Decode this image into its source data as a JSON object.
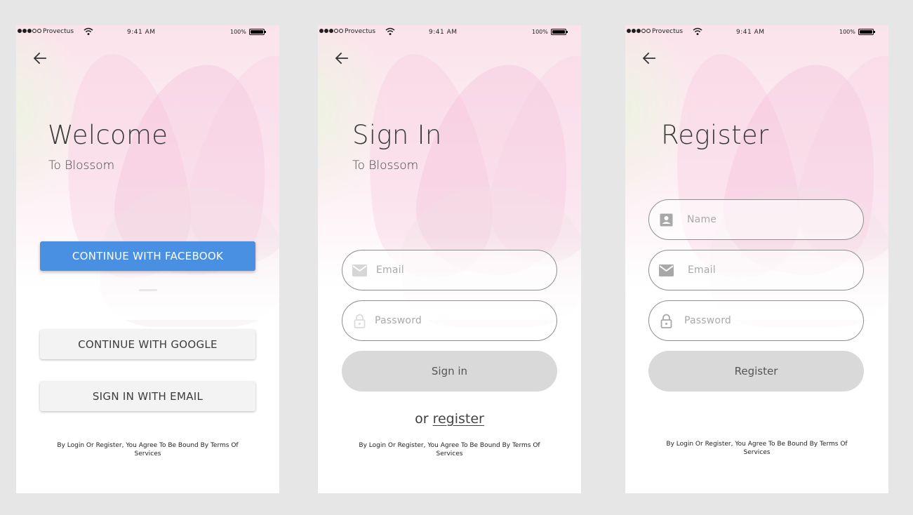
{
  "status_bar": {
    "carrier": "Provectus",
    "signal_bars_filled": 3,
    "signal_bars_total": 5,
    "time": "9:41 AM",
    "battery": "100%"
  },
  "colors": {
    "facebook_blue": "#4a90e2",
    "light_button": "#f3f3f3",
    "pill_button": "#d9d9d9",
    "canvas": "#e6e6e6"
  },
  "welcome": {
    "back_icon": "arrow-left-icon",
    "title": "Welcome",
    "subtitle": "To Blossom",
    "facebook_button": "CONTINUE WITH FACEBOOK",
    "google_button": "CONTINUE WITH GOOGLE",
    "email_button": "SIGN IN WITH EMAIL",
    "terms": "By Login Or Register, You Agree To Be Bound By Terms Of Services"
  },
  "signin": {
    "back_icon": "arrow-left-icon",
    "title": "Sign In",
    "subtitle": "To Blossom",
    "email_placeholder": "Email",
    "email_icon": "mail-icon",
    "password_placeholder": "Password",
    "password_icon": "lock-icon",
    "submit_button": "Sign in",
    "or_text": "or",
    "register_link": "register",
    "terms": "By Login Or Register, You Agree To Be Bound By Terms Of Services"
  },
  "register": {
    "back_icon": "arrow-left-icon",
    "title": "Register",
    "name_placeholder": "Name",
    "name_icon": "contact-icon",
    "email_placeholder": "Email",
    "email_icon": "mail-icon",
    "password_placeholder": "Password",
    "password_icon": "lock-icon",
    "submit_button": "Register",
    "terms": "By Login Or Register, You Agree To Be Bound By Terms Of Services"
  }
}
